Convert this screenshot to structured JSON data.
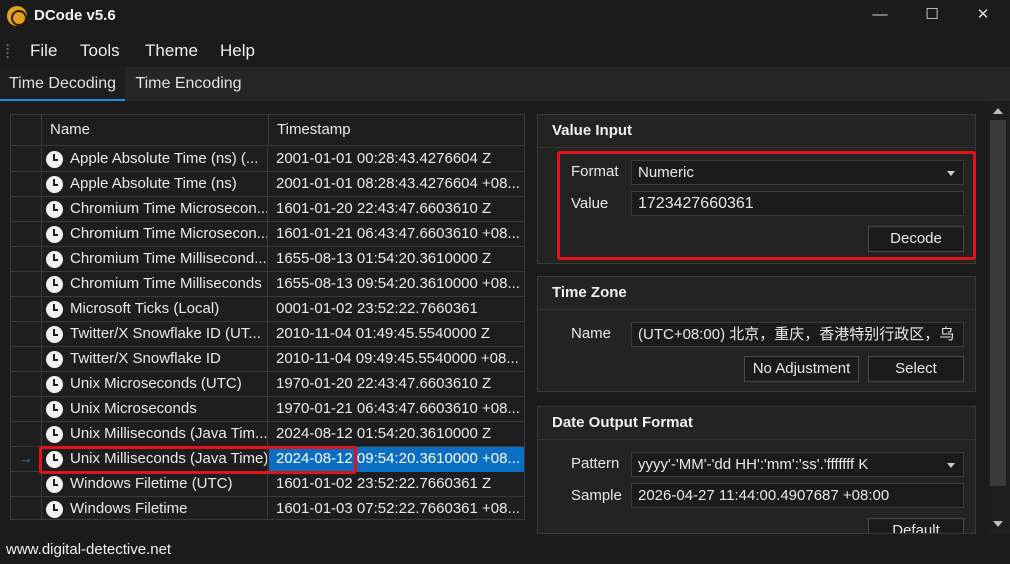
{
  "app": {
    "title": "DCode v5.6"
  },
  "window_controls": {
    "minimize": "—",
    "maximize": "☐",
    "close": "✕"
  },
  "menu": [
    "File",
    "Tools",
    "Theme",
    "Help"
  ],
  "tabs": [
    {
      "label": "Time Decoding",
      "active": true
    },
    {
      "label": "Time Encoding",
      "active": false
    }
  ],
  "list": {
    "columns": [
      "Name",
      "Timestamp"
    ],
    "selected_index": 12,
    "selection_marker": "→",
    "rows": [
      {
        "name": "Apple Absolute Time (ns) (...",
        "timestamp": "2001-01-01 00:28:43.4276604 Z"
      },
      {
        "name": "Apple Absolute Time (ns)",
        "timestamp": "2001-01-01 08:28:43.4276604 +08..."
      },
      {
        "name": "Chromium Time Microsecon...",
        "timestamp": "1601-01-20 22:43:47.6603610 Z"
      },
      {
        "name": "Chromium Time Microsecon...",
        "timestamp": "1601-01-21 06:43:47.6603610 +08..."
      },
      {
        "name": "Chromium Time Millisecond...",
        "timestamp": "1655-08-13 01:54:20.3610000 Z"
      },
      {
        "name": "Chromium Time Milliseconds",
        "timestamp": "1655-08-13 09:54:20.3610000 +08..."
      },
      {
        "name": "Microsoft Ticks (Local)",
        "timestamp": "0001-01-02 23:52:22.7660361"
      },
      {
        "name": "Twitter/X Snowflake ID (UT...",
        "timestamp": "2010-11-04 01:49:45.5540000 Z"
      },
      {
        "name": "Twitter/X Snowflake ID",
        "timestamp": "2010-11-04 09:49:45.5540000 +08..."
      },
      {
        "name": "Unix Microseconds (UTC)",
        "timestamp": "1970-01-20 22:43:47.6603610 Z"
      },
      {
        "name": "Unix Microseconds",
        "timestamp": "1970-01-21 06:43:47.6603610 +08..."
      },
      {
        "name": "Unix Milliseconds (Java Tim...",
        "timestamp": "2024-08-12 01:54:20.3610000 Z"
      },
      {
        "name": "Unix Milliseconds (Java Time)",
        "timestamp": "2024-08-12 09:54:20.3610000 +08..."
      },
      {
        "name": "Windows Filetime (UTC)",
        "timestamp": "1601-01-02 23:52:22.7660361 Z"
      },
      {
        "name": "Windows Filetime",
        "timestamp": "1601-01-03 07:52:22.7660361 +08..."
      }
    ]
  },
  "value_input": {
    "title": "Value Input",
    "format_label": "Format",
    "format_value": "Numeric",
    "value_label": "Value",
    "value": "1723427660361",
    "decode_button": "Decode"
  },
  "time_zone": {
    "title": "Time Zone",
    "name_label": "Name",
    "name_value": "(UTC+08:00) 北京，重庆，香港特别行政区，乌",
    "no_adjustment_button": "No Adjustment",
    "select_button": "Select"
  },
  "date_output": {
    "title": "Date Output Format",
    "pattern_label": "Pattern",
    "pattern_value": "yyyy'-'MM'-'dd HH':'mm':'ss'.'fffffff K",
    "sample_label": "Sample",
    "sample_value": "2026-04-27 11:44:00.4907687 +08:00",
    "default_button": "Default"
  },
  "footer": {
    "text": "www.digital-detective.net"
  },
  "colors": {
    "accent": "#0a6fc2",
    "highlight": "#e0121a",
    "icon": "#e3a11b"
  }
}
